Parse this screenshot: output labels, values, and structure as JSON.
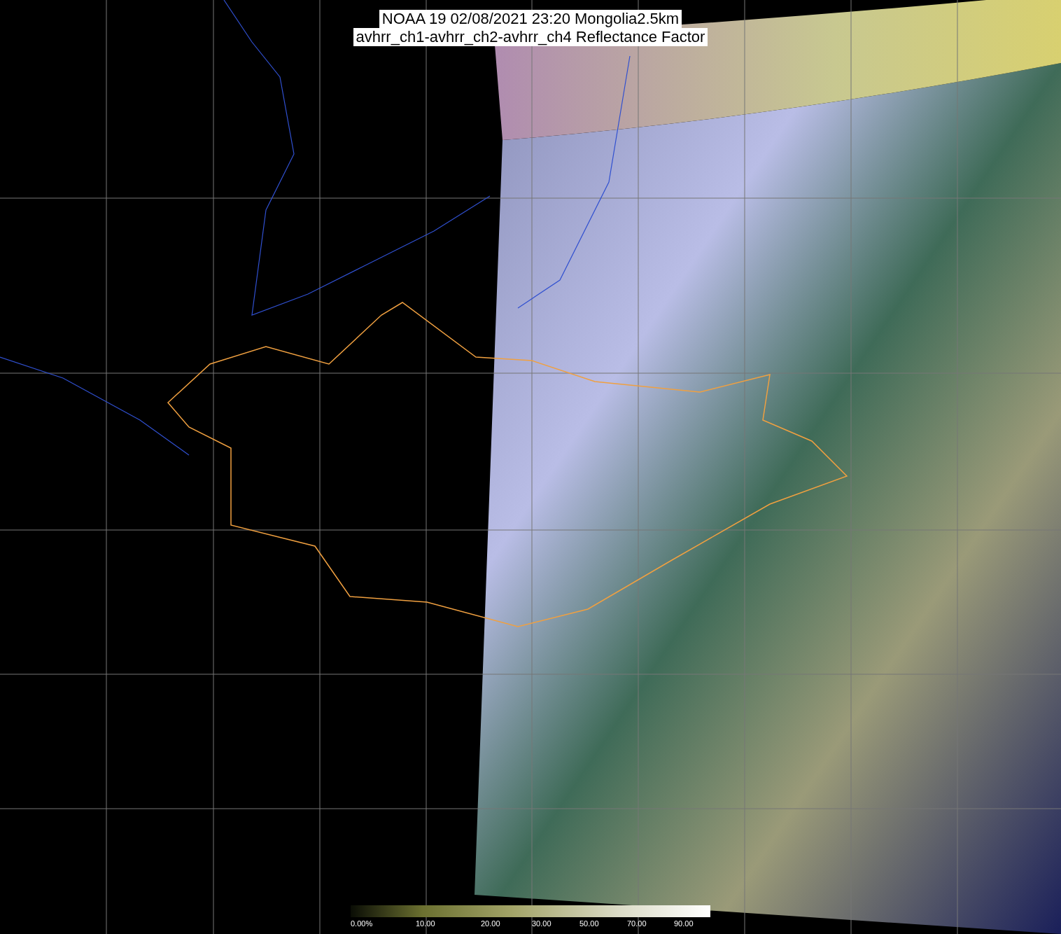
{
  "title_lines": [
    "NOAA 19 02/08/2021 23:20 Mongolia2.5km",
    "avhrr_ch1-avhrr_ch2-avhrr_ch4 Reflectance Factor"
  ],
  "colorbar": {
    "tick_labels": [
      "0.00%",
      "10.00",
      "20.00",
      "30.00",
      "50.00",
      "70.00",
      "90.00"
    ]
  }
}
